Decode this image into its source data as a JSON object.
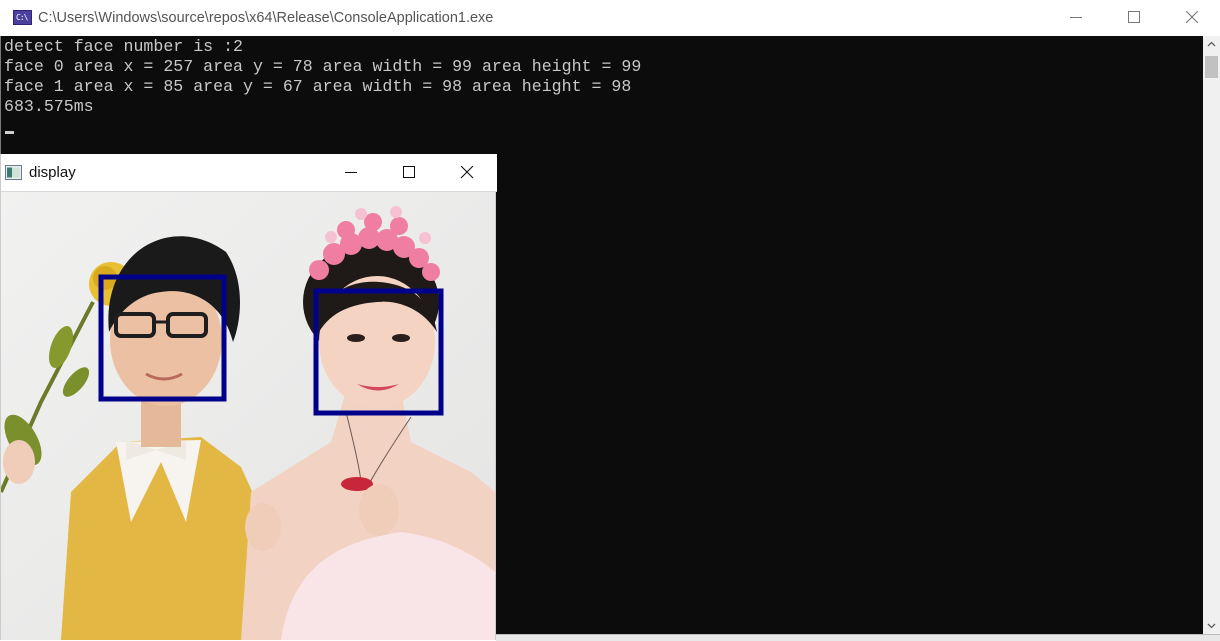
{
  "console_window": {
    "title": "C:\\Users\\Windows\\source\\repos\\x64\\Release\\ConsoleApplication1.exe",
    "icon_text": "C:\\",
    "output_lines": [
      "detect face number is :2",
      "face 0 area x = 257 area y = 78 area width = 99 area height = 99",
      "face 1 area x = 85 area y = 67 area width = 98 area height = 98",
      "683.575ms"
    ],
    "controls": [
      "minimize-icon",
      "maximize-icon",
      "close-icon"
    ]
  },
  "display_window": {
    "title": "display",
    "controls": [
      "minimize-icon",
      "maximize-icon",
      "close-icon"
    ],
    "box_color": "#00008b"
  },
  "colors": {
    "console_bg": "#0c0c0c",
    "console_text": "#c8c8c8",
    "face_box": "#00008b"
  }
}
